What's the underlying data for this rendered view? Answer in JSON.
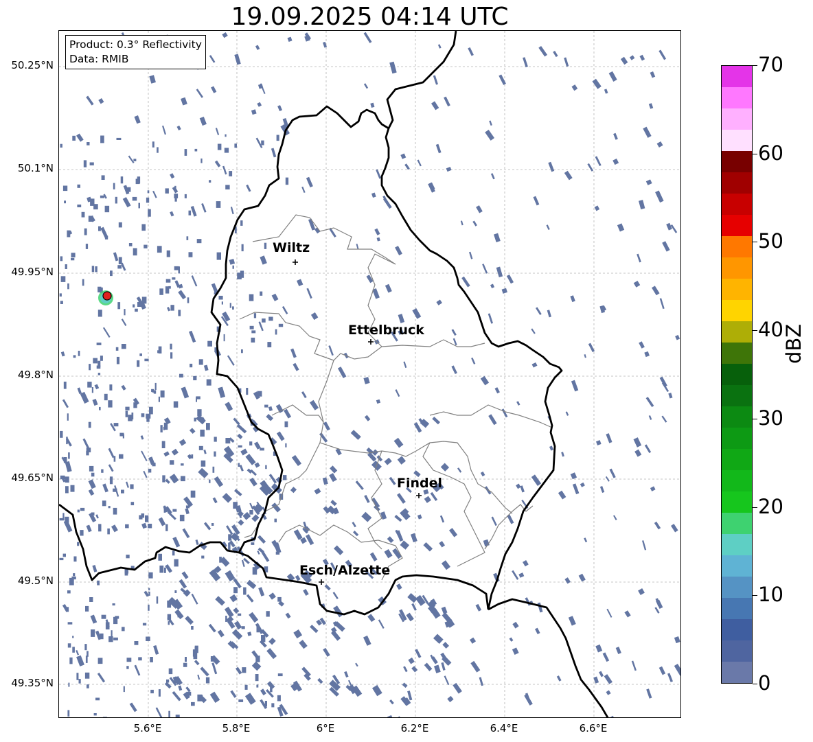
{
  "title": "19.09.2025 04:14 UTC",
  "info": {
    "product": "Product: 0.3° Reflectivity",
    "source": "Data: RMIB"
  },
  "lat_labels": [
    "50.25°N",
    "50.1°N",
    "49.95°N",
    "49.8°N",
    "49.65°N",
    "49.5°N",
    "49.35°N"
  ],
  "lon_labels": [
    "5.6°E",
    "5.8°E",
    "6°E",
    "6.2°E",
    "6.4°E",
    "6.6°E"
  ],
  "cities": [
    {
      "name": "Wiltz"
    },
    {
      "name": "Ettelbruck"
    },
    {
      "name": "Findel"
    },
    {
      "name": "Esch/Alzette"
    }
  ],
  "colorbar": {
    "label": "dBZ",
    "ticks": [
      "0",
      "10",
      "20",
      "30",
      "40",
      "50",
      "60",
      "70"
    ],
    "colors": [
      "#6a79a9",
      "#4f65a0",
      "#3f5ea0",
      "#4777b2",
      "#5593c4",
      "#5fb3d4",
      "#5ecfc4",
      "#3ed270",
      "#16c61d",
      "#12b81a",
      "#10a815",
      "#0d9a14",
      "#0c8a12",
      "#0a7210",
      "#07600b",
      "#3e7508",
      "#aeae06",
      "#ffd400",
      "#ffb400",
      "#ff9600",
      "#ff7800",
      "#e60000",
      "#c80000",
      "#a00000",
      "#780000",
      "#ffe0ff",
      "#ffb0ff",
      "#ff78ff",
      "#e434e8"
    ]
  },
  "radar_site_color": "#e02020",
  "echo_color": "#6275a2"
}
